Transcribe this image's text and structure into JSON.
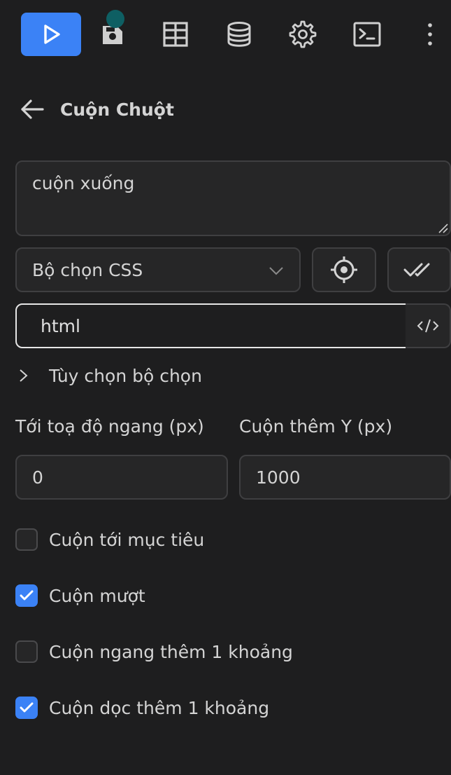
{
  "toolbar": {
    "items": [
      {
        "icon": "play-icon",
        "active": true
      },
      {
        "icon": "record-icon",
        "active": false
      },
      {
        "icon": "table-icon",
        "active": false
      },
      {
        "icon": "database-icon",
        "active": false
      },
      {
        "icon": "gear-icon",
        "active": false
      },
      {
        "icon": "terminal-icon",
        "active": false
      },
      {
        "icon": "more-vertical-icon",
        "active": false
      }
    ],
    "accent_color": "#3b82f6"
  },
  "header": {
    "title": "Cuộn Chuột"
  },
  "description": {
    "value": "cuộn xuống"
  },
  "selector": {
    "type_value": "Bộ chọn CSS",
    "value": "html",
    "options_label": "Tùy chọn bộ chọn"
  },
  "scroll": {
    "x_label": "Tới toạ độ ngang (px)",
    "x_value": "0",
    "y_label": "Cuộn thêm Y (px)",
    "y_value": "1000"
  },
  "checkboxes": [
    {
      "label": "Cuộn tới mục tiêu",
      "checked": false
    },
    {
      "label": "Cuộn mượt",
      "checked": true
    },
    {
      "label": "Cuộn ngang thêm 1 khoảng",
      "checked": false
    },
    {
      "label": "Cuộn dọc thêm 1 khoảng",
      "checked": true
    }
  ]
}
